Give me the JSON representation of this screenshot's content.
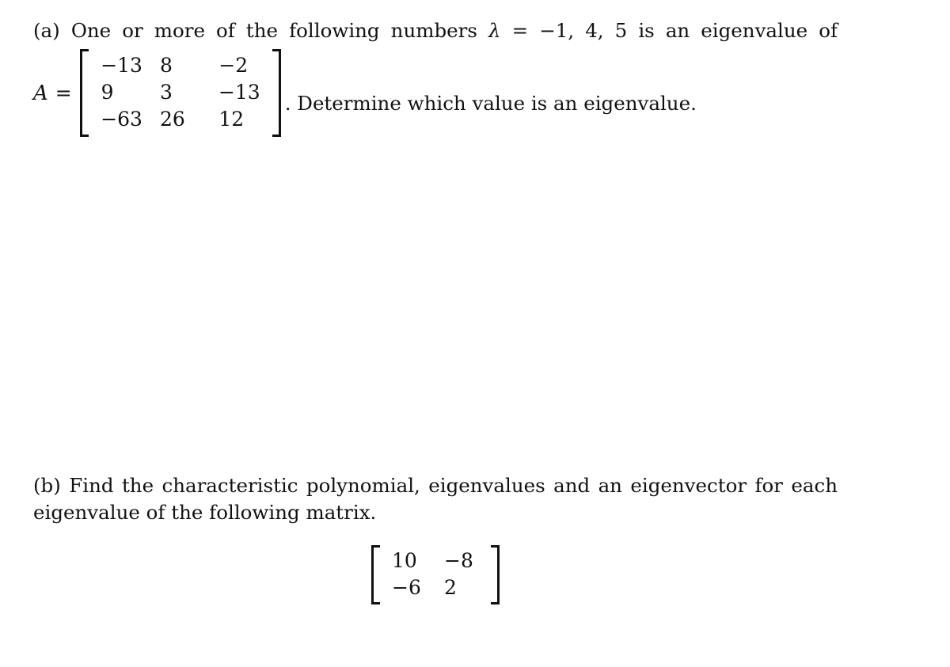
{
  "document": {
    "background_color": "#ffffff",
    "text_color": "#111111"
  },
  "part_a": {
    "label": "(a)",
    "lead_text": "One or more of the following numbers",
    "lambda_symbol": "λ",
    "equals": "=",
    "candidate_values": "−1, 4, 5",
    "lead_text_tail": "is an eigenvalue of",
    "matrix_label": "A",
    "matrix_equals": "=",
    "matrix": {
      "rows": 3,
      "cols": 3,
      "values": [
        [
          "−13",
          "8",
          "−2"
        ],
        [
          "9",
          "3",
          "−13"
        ],
        [
          "−63",
          "26",
          "12"
        ]
      ]
    },
    "after_matrix_text": ". Determine which value is an eigenvalue."
  },
  "part_b": {
    "label": "(b)",
    "line1": "Find the characteristic polynomial, eigenvalues and an eigenvector for each",
    "line2": "eigenvalue of the following matrix.",
    "matrix": {
      "rows": 2,
      "cols": 2,
      "values": [
        [
          "10",
          "−8"
        ],
        [
          "−6",
          "2"
        ]
      ]
    }
  }
}
